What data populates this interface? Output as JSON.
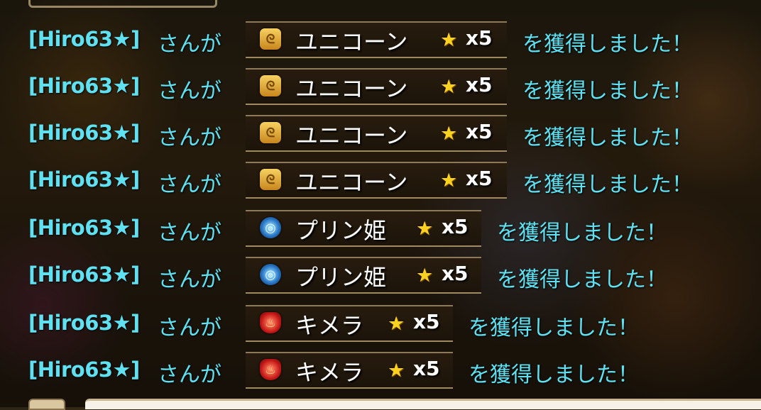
{
  "chat_log": {
    "entries": [
      {
        "user": "[Hiro63★]",
        "verb": "さんが",
        "monster": "ユニコーン",
        "element_icon": "wind-attribute-icon",
        "grade": "x5",
        "suffix": "を獲得しました！"
      },
      {
        "user": "[Hiro63★]",
        "verb": "さんが",
        "monster": "ユニコーン",
        "element_icon": "wind-attribute-icon",
        "grade": "x5",
        "suffix": "を獲得しました！"
      },
      {
        "user": "[Hiro63★]",
        "verb": "さんが",
        "monster": "ユニコーン",
        "element_icon": "wind-attribute-icon",
        "grade": "x5",
        "suffix": "を獲得しました！"
      },
      {
        "user": "[Hiro63★]",
        "verb": "さんが",
        "monster": "ユニコーン",
        "element_icon": "wind-attribute-icon",
        "grade": "x5",
        "suffix": "を獲得しました！"
      },
      {
        "user": "[Hiro63★]",
        "verb": "さんが",
        "monster": "プリン姫",
        "element_icon": "water-attribute-icon",
        "grade": "x5",
        "suffix": "を獲得しました！"
      },
      {
        "user": "[Hiro63★]",
        "verb": "さんが",
        "monster": "プリン姫",
        "element_icon": "water-attribute-icon",
        "grade": "x5",
        "suffix": "を獲得しました！"
      },
      {
        "user": "[Hiro63★]",
        "verb": "さんが",
        "monster": "キメラ",
        "element_icon": "fire-attribute-icon",
        "grade": "x5",
        "suffix": "を獲得しました！"
      },
      {
        "user": "[Hiro63★]",
        "verb": "さんが",
        "monster": "キメラ",
        "element_icon": "fire-attribute-icon",
        "grade": "x5",
        "suffix": "を獲得しました！"
      }
    ]
  },
  "colors": {
    "username": "#5fe1f2",
    "monster_name": "#ffffff",
    "star": "#ffd21f"
  }
}
